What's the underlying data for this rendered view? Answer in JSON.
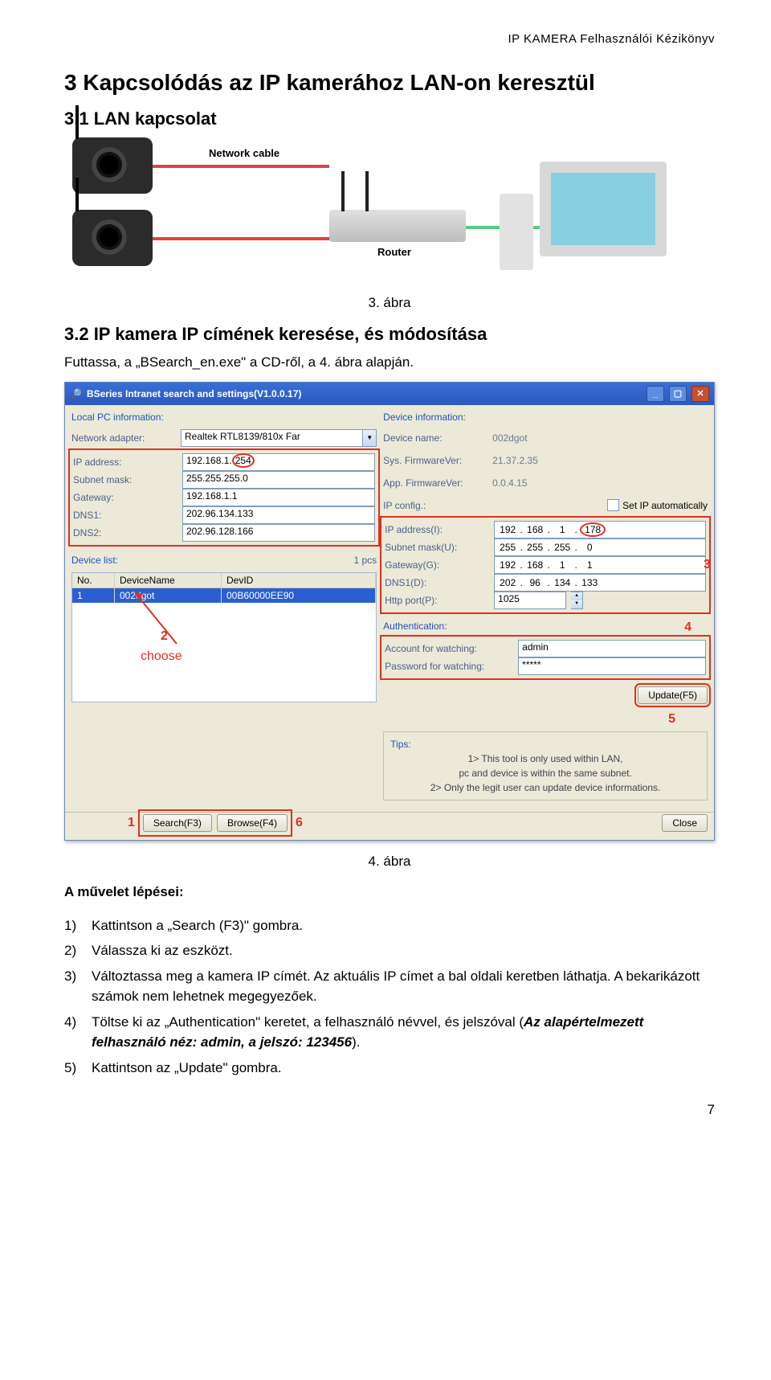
{
  "running_header": "IP KAMERA Felhasználói Kézikönyv",
  "h1": "3  Kapcsolódás az IP kamerához LAN-on keresztül",
  "h2_1": "3.1  LAN kapcsolat",
  "diagram": {
    "cable_label": "Network cable",
    "router_label": "Router"
  },
  "fig3": "3. ábra",
  "h2_2": "3.2  IP kamera IP címének keresése, és módosítása",
  "p_run": "Futtassa, a „BSearch_en.exe\" a CD-ről, a 4. ábra alapján.",
  "app": {
    "title": "BSeries Intranet search and settings(V1.0.0.17)",
    "left": {
      "group1": "Local PC information:",
      "adapter_label": "Network adapter:",
      "adapter_value": "Realtek RTL8139/810x Far",
      "ip_label": "IP address:",
      "ip_value": "192.168.1.254",
      "mask_label": "Subnet mask:",
      "mask_value": "255.255.255.0",
      "gw_label": "Gateway:",
      "gw_value": "192.168.1.1",
      "dns1_label": "DNS1:",
      "dns1_value": "202.96.134.133",
      "dns2_label": "DNS2:",
      "dns2_value": "202.96.128.166",
      "group2": "Device list:",
      "pcs": "1 pcs",
      "thead_no": "No.",
      "thead_name": "DeviceName",
      "thead_id": "DevID",
      "row_no": "1",
      "row_name": "002dgot",
      "row_id": "00B60000EE90"
    },
    "right": {
      "group1": "Device information:",
      "devname_label": "Device name:",
      "devname_value": "002dgot",
      "sysfw_label": "Sys. FirmwareVer:",
      "sysfw_value": "21.37.2.35",
      "appfw_label": "App. FirmwareVer:",
      "appfw_value": "0.0.4.15",
      "ipcfg_label": "IP config.:",
      "setip_auto": "Set IP automatically",
      "ipaddr_label": "IP address(I):",
      "ipaddr": [
        "192",
        "168",
        "1",
        "178"
      ],
      "subnet_label": "Subnet mask(U):",
      "subnet": [
        "255",
        "255",
        "255",
        "0"
      ],
      "gateway_label": "Gateway(G):",
      "gateway": [
        "192",
        "168",
        "1",
        "1"
      ],
      "dns1_label": "DNS1(D):",
      "dns1": [
        "202",
        "96",
        "134",
        "133"
      ],
      "http_label": "Http port(P):",
      "http_value": "1025",
      "group2": "Authentication:",
      "acct_label": "Account for watching:",
      "acct_value": "admin",
      "pwd_label": "Password for watching:",
      "pwd_value": "*****",
      "update_btn": "Update(F5)",
      "tips_label": "Tips:",
      "tip1": "1> This tool is only used within LAN,",
      "tip1b": "pc and device is within the same subnet.",
      "tip2": "2> Only the legit user can update device informations."
    },
    "bottom": {
      "search": "Search(F3)",
      "browse": "Browse(F4)",
      "close": "Close"
    },
    "annotations": {
      "a1": "1",
      "a2": "2",
      "a3": "3",
      "a4": "4",
      "a5": "5",
      "a6": "6",
      "choose": "choose"
    }
  },
  "fig4": "4. ábra",
  "steps_title": "A művelet lépései:",
  "steps": [
    {
      "n": "1)",
      "t": "Kattintson a „Search (F3)\" gombra."
    },
    {
      "n": "2)",
      "t": "Válassza ki az eszközt."
    },
    {
      "n": "3)",
      "t": "Változtassa meg a kamera IP címét. Az aktuális IP címet a bal oldali keretben láthatja. A bekarikázott számok nem lehetnek megegyezőek."
    },
    {
      "n": "4)",
      "t_before": "Töltse ki az „Authentication\" keretet, a felhasználó névvel, és jelszóval (",
      "t_emph": "Az alapértelmezett felhasználó néz: admin, a jelszó: 123456",
      "t_after": ")."
    },
    {
      "n": "5)",
      "t": "Kattintson az „Update\" gombra."
    }
  ],
  "page_number": "7"
}
